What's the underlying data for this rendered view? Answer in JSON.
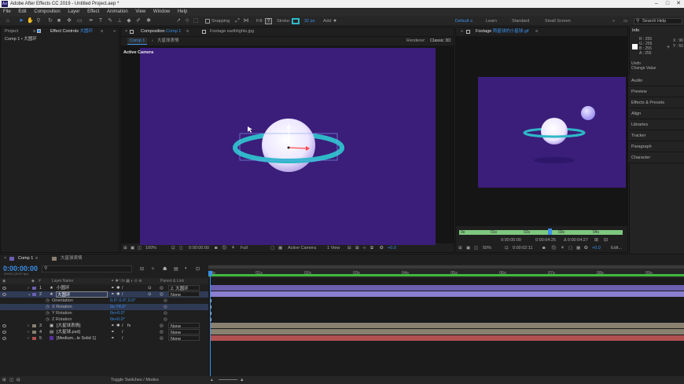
{
  "app": {
    "title": "Adobe After Effects CC 2019 - Untitled Project.aep *",
    "logo_text": "Ae",
    "window_controls": [
      "–",
      "□",
      "✕"
    ]
  },
  "menu": [
    "File",
    "Edit",
    "Composition",
    "Layer",
    "Effect",
    "Animation",
    "View",
    "Window",
    "Help"
  ],
  "toolbar": {
    "snapping_label": "Snapping",
    "fill_label": "Fill:",
    "stroke_label": "Stroke:",
    "stroke_px": "32 px",
    "add_label": "Add:",
    "workspaces": [
      "Default",
      "Learn",
      "Standard",
      "Small Screen"
    ],
    "search_placeholder": "Search Help",
    "colors": {
      "fill": "#3a3a3a",
      "stroke": "#2fb8c8"
    }
  },
  "project_panel": {
    "tab_project": "Project",
    "tab_effect_controls": "Effect Controls",
    "effect_controls_layer": "大圆环",
    "breadcrumb": "Comp 1 • 大圆环"
  },
  "composition_panel": {
    "tab_label": "Composition",
    "tab_name": "Comp 1",
    "footage_tab": "Footage earthlights.jpg",
    "subtabs": [
      "Comp 1",
      "大星球表情"
    ],
    "renderer_label": "Renderer:",
    "renderer_value": "Classic 3D",
    "active_camera": "Active Camera",
    "bottom": {
      "zoom": "100%",
      "timecode": "0:00:00:00",
      "resolution": "Full",
      "camera": "Active Camera",
      "view": "1 View",
      "offset": "+0.0"
    },
    "bg_color": "#3b1e7a"
  },
  "footage_panel": {
    "tab_label": "Footage",
    "tab_name": "两星球的小星球.gif",
    "timecodes": [
      "0:00:00:00",
      "0:00:04:25",
      "Δ 0:00:04:27"
    ],
    "bottom": {
      "zoom": "50%",
      "timecode": "0:00:02:11",
      "offset": "+0.0",
      "extra": "Edit..."
    },
    "ruler_labels": [
      "0s",
      "01s",
      "02s",
      "03s",
      "04s"
    ]
  },
  "info_panel": {
    "title": "Info",
    "rgba": [
      "R : 255",
      "G : 255",
      "B : 255",
      "A : 255"
    ],
    "xy": [
      "X : 96",
      "Y : 55"
    ],
    "undo_label": "Undo",
    "undo_action": "Change Value",
    "items": [
      "Audio",
      "Preview",
      "Effects & Presets",
      "Align",
      "Libraries",
      "Tracker",
      "Paragraph",
      "Character"
    ]
  },
  "timeline": {
    "tab_comp": "Comp 1",
    "tab_other": "大星球表情",
    "timecode": "0:00:00:00",
    "timecode_sub": "00000 (25.00 fps)",
    "header": {
      "source_name": "Layer Name",
      "parent": "Parent & Link"
    },
    "ruler": [
      "0s",
      "01s",
      "02s",
      "03s",
      "04s",
      "05s",
      "06s",
      "07s",
      "08s",
      "09s"
    ],
    "layers": [
      {
        "num": "1",
        "name": "小圆环",
        "parent": "2. 大圆环",
        "color": "#6b5fb0"
      },
      {
        "num": "2",
        "name": "大圆环",
        "parent": "None",
        "color": "#6b5fb0"
      },
      {
        "num": "3",
        "name": "[大星球表情]",
        "parent": "None",
        "color": "#8a8070"
      },
      {
        "num": "4",
        "name": "[大星球.psd]",
        "parent": "None",
        "color": "#8a8070"
      },
      {
        "num": "5",
        "name": "[Medium...le Solid 1]",
        "parent": "None",
        "color": "#b05050"
      }
    ],
    "properties": [
      {
        "name": "Orientation",
        "value": "0.0°,0.0°,0.0°"
      },
      {
        "name": "X Rotation",
        "value": "0x-74.0°"
      },
      {
        "name": "Y Rotation",
        "value": "0x+0.0°"
      },
      {
        "name": "Z Rotation",
        "value": "0x+0.0°"
      }
    ],
    "footer": "Toggle Switches / Modes"
  }
}
